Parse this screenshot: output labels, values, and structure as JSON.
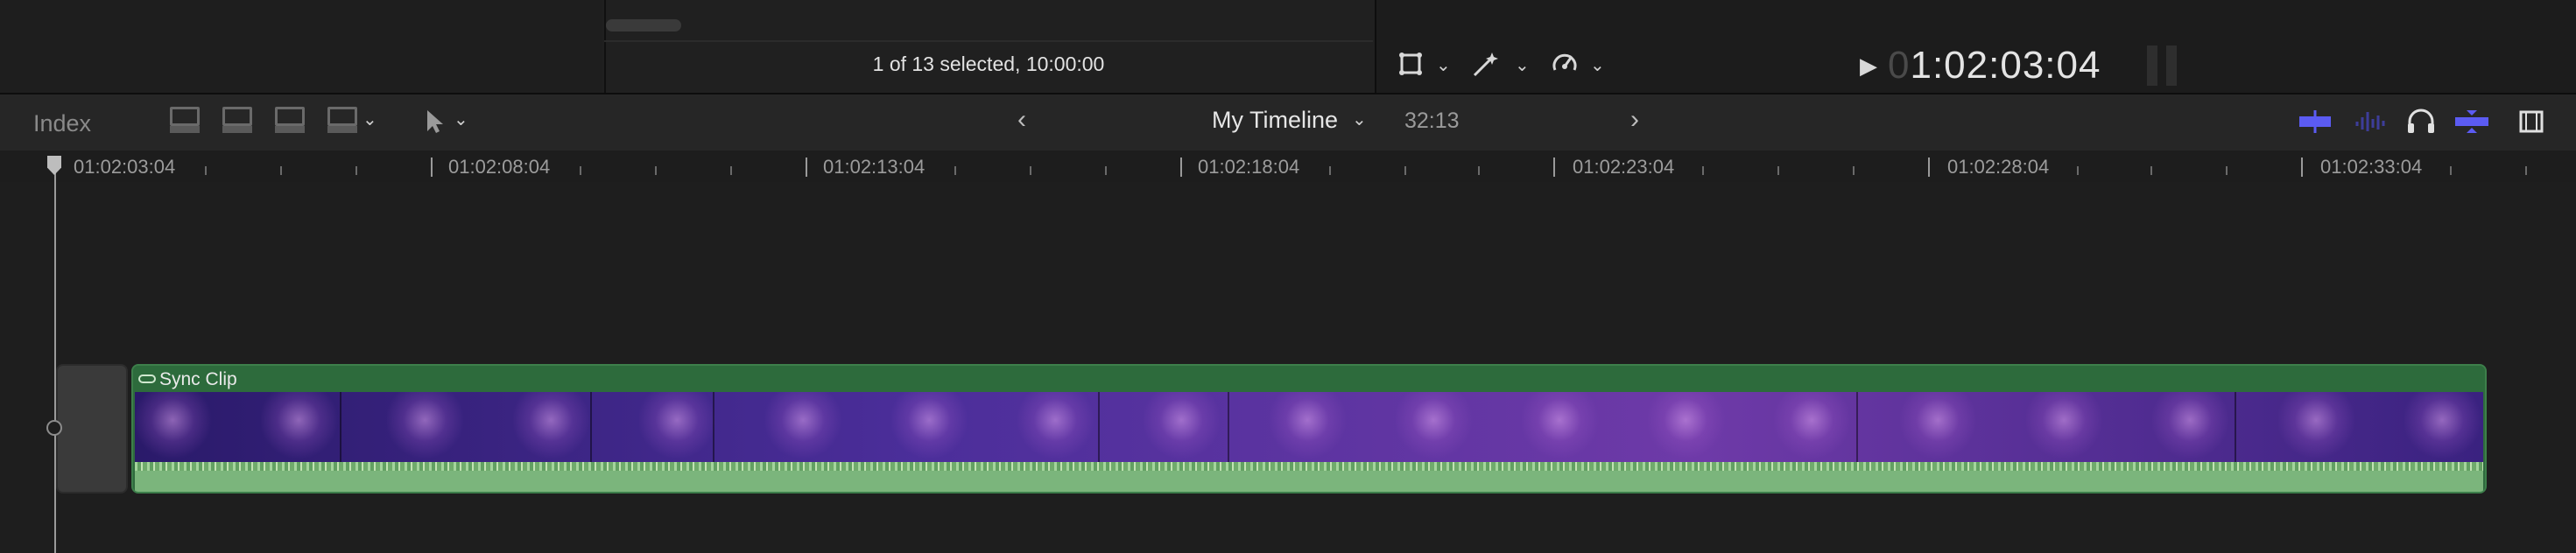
{
  "browser": {
    "selection_status": "1 of 13 selected, 10:00:00"
  },
  "viewer": {
    "timecode_dim": "0",
    "timecode": "1:02:03:04"
  },
  "toolbar": {
    "index_label": "Index",
    "timeline_name": "My Timeline",
    "timeline_duration": "32:13"
  },
  "ruler": {
    "labels": [
      "01:02:03:04",
      "01:02:08:04",
      "01:02:13:04",
      "01:02:18:04",
      "01:02:23:04",
      "01:02:28:04",
      "01:02:33:04"
    ]
  },
  "clip": {
    "name": "Sync Clip"
  },
  "icons": [
    "transform-icon",
    "magic-wand-icon",
    "speed-icon",
    "play-icon",
    "connect-clip-icon",
    "insert-clip-icon",
    "append-clip-icon",
    "overwrite-clip-icon",
    "select-tool-icon",
    "back-arrow-icon",
    "forward-arrow-icon",
    "video-only-icon",
    "audio-waveform-icon",
    "headphones-icon",
    "snapping-icon",
    "clip-appearance-icon",
    "link-icon"
  ],
  "colors": {
    "clip_green": "#2f6a3e",
    "audio_green": "#7bb57c",
    "accent_blue": "#5b5bf2"
  }
}
